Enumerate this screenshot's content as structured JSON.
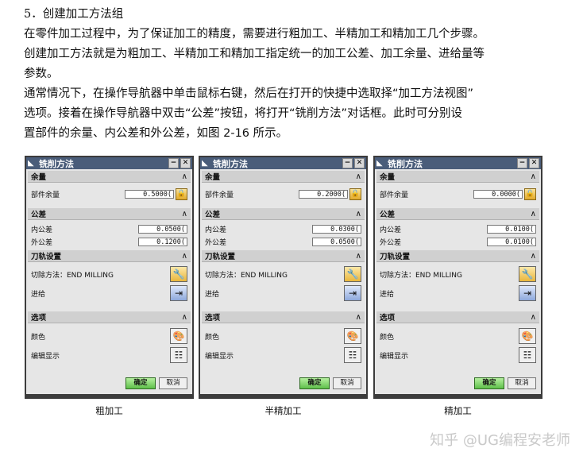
{
  "text": {
    "heading": "5．创建加工方法组",
    "p1_line1": "在零件加工过程中，为了保证加工的精度，需要进行粗加工、半精加工和精加工几个步骤。",
    "p1_line2": "创建加工方法就是为粗加工、半精加工和精加工指定统一的加工公差、加工余量、进给量等",
    "p1_line3": "参数。",
    "p2_line1": "通常情况下，在操作导航器中单击鼠标右键，然后在打开的快捷中选取择“加工方法视图”",
    "p2_line2": "选项。接着在操作导航器中双击“公差”按钮，将打开“铣削方法”对话框。此时可分别设",
    "p2_line3": "置部件的余量、内公差和外公差，如图 2-16 所示。"
  },
  "labels": {
    "dialog_title": "铣削方法",
    "minimize": "−",
    "close": "✕",
    "sec_stock": "余量",
    "part_stock": "部件余量",
    "sec_tolerance": "公差",
    "intol": "内公差",
    "outtol": "外公差",
    "sec_path": "刀轨设置",
    "cut_method": "切除方法：END MILLING",
    "feed": "进给",
    "sec_options": "选项",
    "color": "颜色",
    "edit_display": "编辑显示",
    "ok": "确定",
    "cancel": "取消",
    "collapse": "∧"
  },
  "dialogs": [
    {
      "part_stock": "0.5000(",
      "intol": "0.0500(",
      "outtol": "0.1200(",
      "caption": "粗加工"
    },
    {
      "part_stock": "0.2000(",
      "intol": "0.0300(",
      "outtol": "0.0500(",
      "caption": "半精加工"
    },
    {
      "part_stock": "0.0000(",
      "intol": "0.0100(",
      "outtol": "0.0100(",
      "caption": "精加工"
    }
  ],
  "watermark": "知乎 @UG编程安老师"
}
